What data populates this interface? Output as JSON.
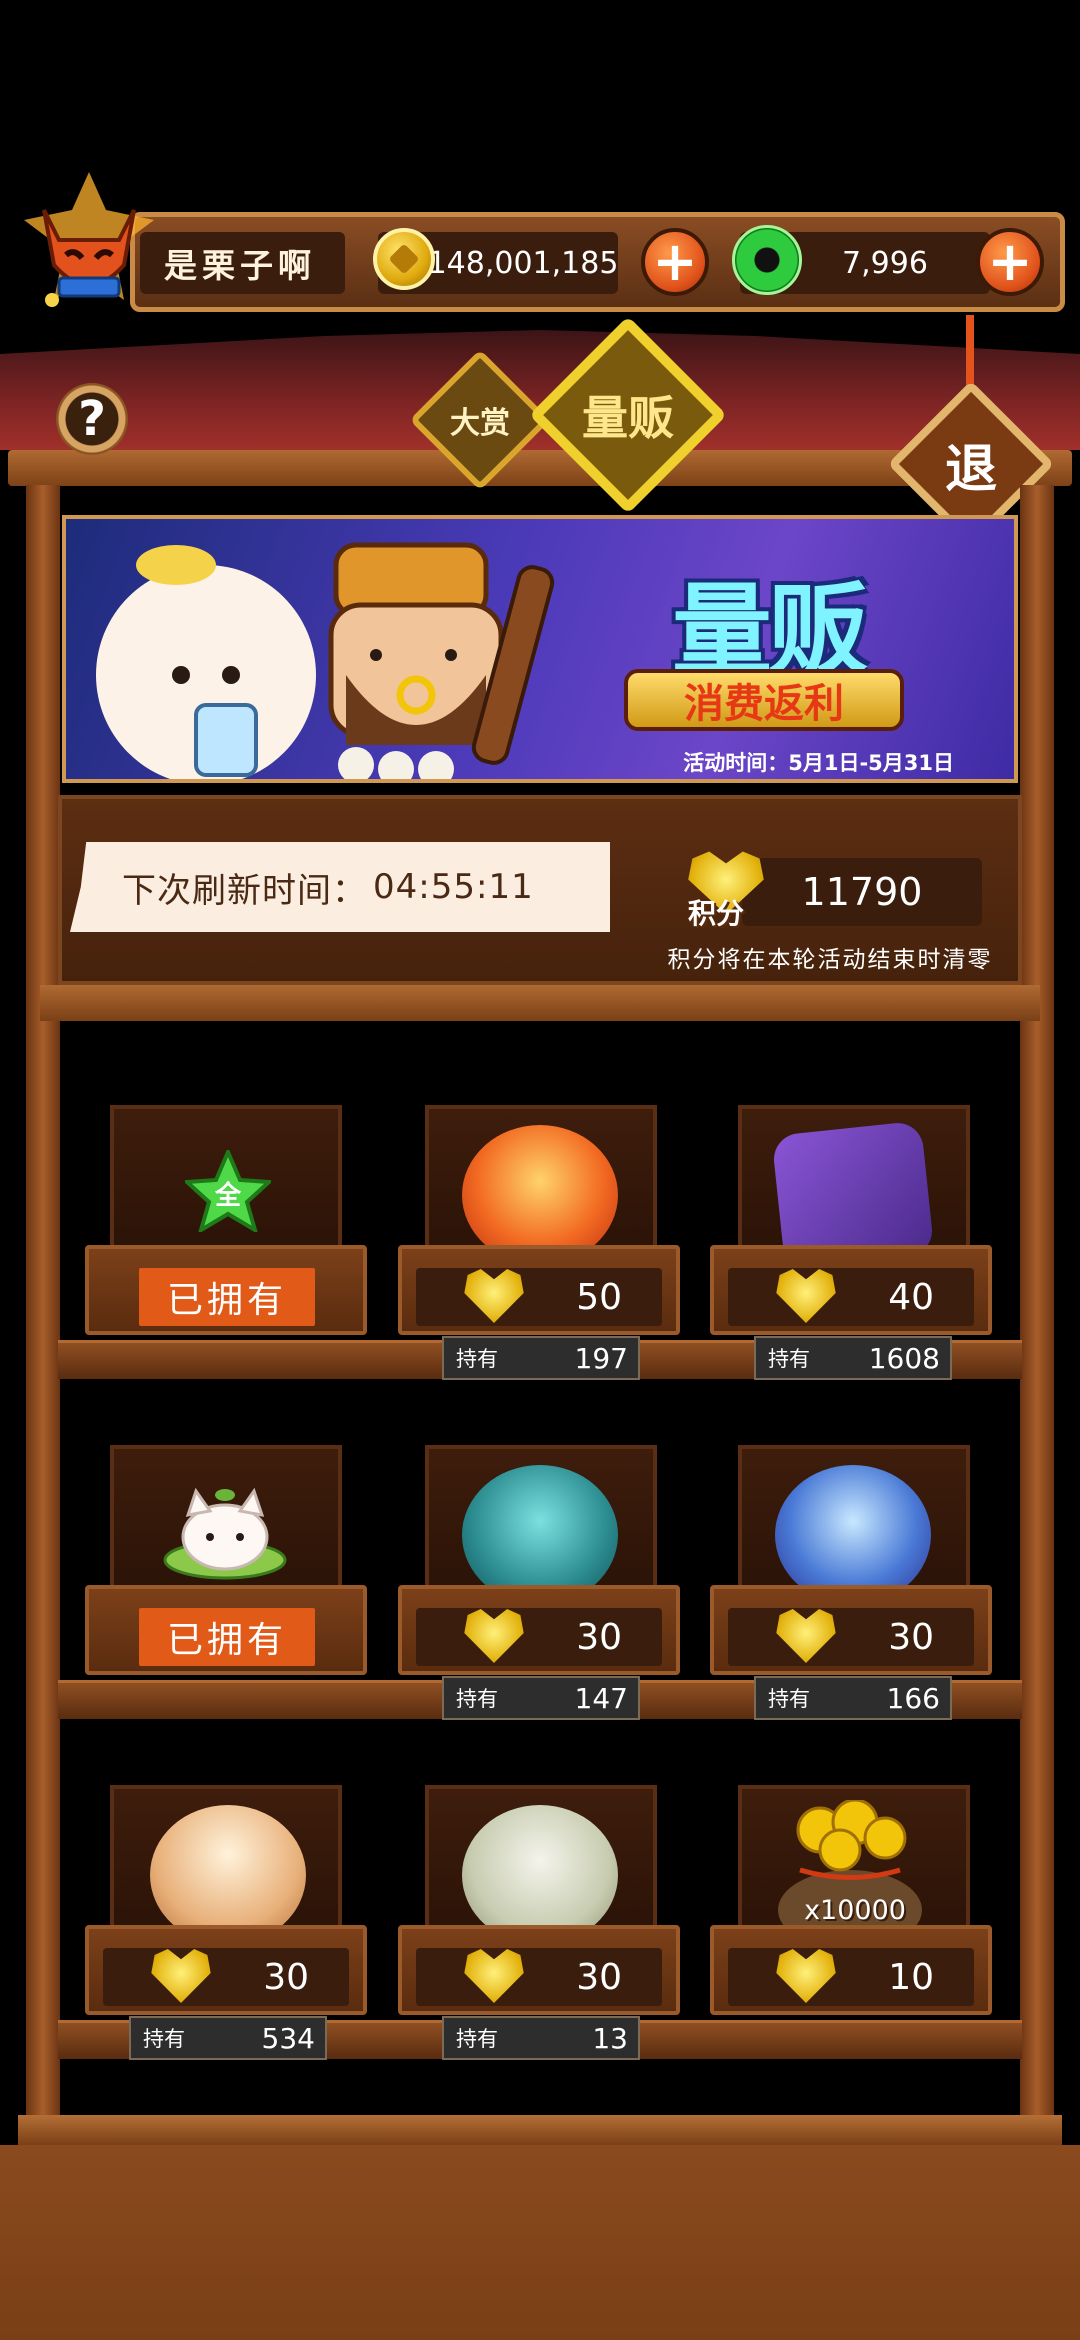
{
  "player": {
    "name": "是栗子啊",
    "avatar_icon": "fox-mask-avatar-icon"
  },
  "currency": {
    "coins": "148,001,185",
    "jade": "7,996"
  },
  "nav": {
    "help_label": "?",
    "tab_dashang": "大赏",
    "tab_liangfan": "量贩",
    "exit_label": "退"
  },
  "banner": {
    "title": "量贩",
    "subtitle": "消费返利",
    "time": "活动时间：5月1日-5月31日"
  },
  "refresh": {
    "label": "下次刷新时间：",
    "time": "04:55:11"
  },
  "points": {
    "icon_label": "积分",
    "value": "11790",
    "note": "积分将在本轮活动结束时清零"
  },
  "shop": {
    "held_label": "持有",
    "owned_label": "已拥有",
    "items": [
      {
        "name": "green-star-item",
        "owned": true
      },
      {
        "name": "fire-orb-item",
        "price": "50",
        "held": "197"
      },
      {
        "name": "purple-dice-item",
        "price": "40",
        "held": "1608"
      },
      {
        "name": "cat-pet-item",
        "owned": true
      },
      {
        "name": "teal-dice-orb-item",
        "price": "30",
        "held": "147"
      },
      {
        "name": "blue-cube-orb-item",
        "price": "30",
        "held": "166"
      },
      {
        "name": "lantern-orb-item",
        "price": "30",
        "held": "534"
      },
      {
        "name": "white-dice-orb-item",
        "price": "30",
        "held": "13"
      },
      {
        "name": "coin-bag-item",
        "price": "10",
        "bag_label": "x10000"
      }
    ]
  },
  "colors": {
    "wood": "#7c4019",
    "accent_orange": "#e25a18",
    "banner_cyan": "#7ff3ff"
  }
}
